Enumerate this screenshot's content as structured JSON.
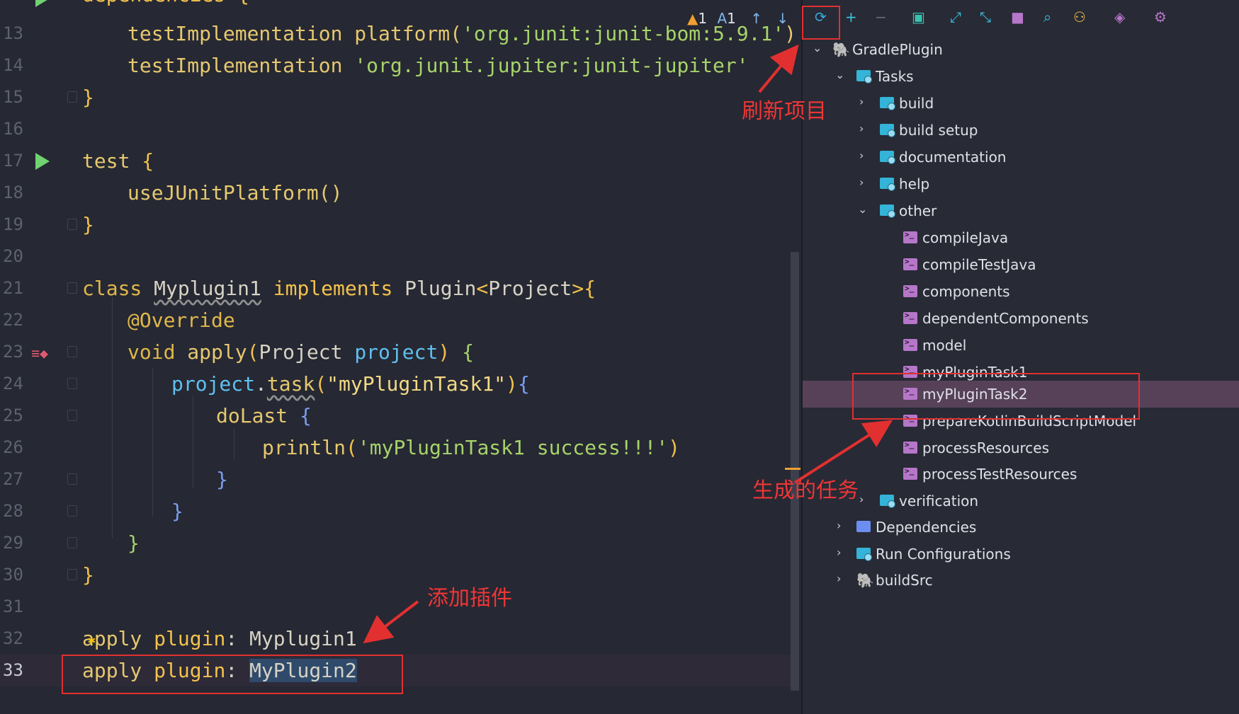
{
  "editor": {
    "line_numbers": [
      "13",
      "14",
      "15",
      "16",
      "17",
      "18",
      "19",
      "20",
      "21",
      "22",
      "23",
      "24",
      "25",
      "26",
      "27",
      "28",
      "29",
      "30",
      "31",
      "32",
      "33"
    ],
    "line12_text": "dependencies {",
    "line13": {
      "ident": "testImplementation",
      "fn": "platform",
      "open": "(",
      "str": "'org.junit:junit-bom:5.9.1'",
      "close": ")"
    },
    "line14": {
      "ident": "testImplementation",
      "str": "'org.junit.jupiter:junit-jupiter'"
    },
    "line15": "}",
    "line17": {
      "kw": "test",
      "brace": "{"
    },
    "line18": {
      "fn": "useJUnitPlatform",
      "parens": "()"
    },
    "line19": "}",
    "line21": {
      "kw": "class",
      "name": "Myplugin1",
      "kw2": "implements",
      "type": "Plugin",
      "lt": "<",
      "generic": "Project",
      "gt": ">",
      "brace": "{"
    },
    "line22": "@Override",
    "line23": {
      "kw": "void",
      "fn": "apply",
      "open": "(",
      "type": "Project",
      "param": "project",
      "close": ")",
      "brace": "{"
    },
    "line24": {
      "var": "project",
      "dot": ".",
      "fn": "task",
      "open": "(",
      "str": "\"myPluginTask1\"",
      "close": ")",
      "brace": "{"
    },
    "line25": {
      "fn": "doLast",
      "brace": "{"
    },
    "line26": {
      "fn": "println",
      "open": "(",
      "str": "'myPluginTask1 success!!!'",
      "close": ")"
    },
    "line27": "}",
    "line28": "}",
    "line29": "}",
    "line30": "}",
    "line32": {
      "kw": "apply",
      "kw2": "plugin",
      "colon": ":",
      "value": "Myplugin1"
    },
    "line33": {
      "kw": "apply",
      "kw2": "plugin",
      "colon": ":",
      "value": "MyPlugin2"
    }
  },
  "inspections": {
    "warnings": "1",
    "typos": "1"
  },
  "gradle": {
    "root": "GradlePlugin",
    "tasks": "Tasks",
    "groups": [
      "build",
      "build setup",
      "documentation",
      "help",
      "other"
    ],
    "other_tasks": [
      "compileJava",
      "compileTestJava",
      "components",
      "dependentComponents",
      "model",
      "myPluginTask1",
      "myPluginTask2",
      "prepareKotlinBuildScriptModel",
      "processResources",
      "processTestResources"
    ],
    "verification": "verification",
    "dependencies": "Dependencies",
    "run_configurations": "Run Configurations",
    "buildsrc": "buildSrc"
  },
  "annotations": {
    "refresh": "刷新项目",
    "generated": "生成的任务",
    "add_plugin": "添加插件"
  },
  "colors": {
    "accent_red": "#e23030",
    "selection": "#574159"
  }
}
